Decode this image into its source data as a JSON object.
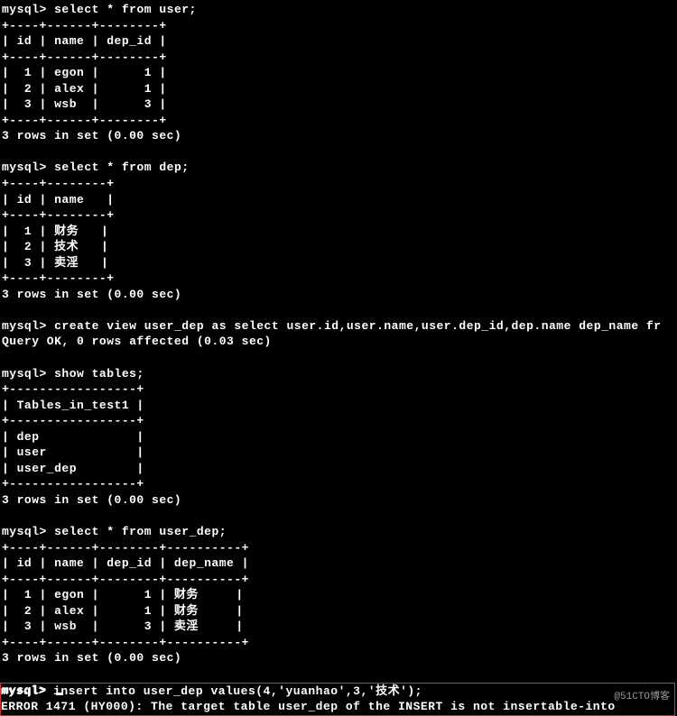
{
  "prompt_text": "mysql>",
  "queries": {
    "select_user": "select * from user;",
    "select_dep": "select * from dep;",
    "create_view": "create view user_dep as select user.id,user.name,user.dep_id,dep.name dep_name fr",
    "show_tables": "show tables;",
    "select_user_dep": "select * from user_dep;",
    "insert_user_dep": "insert into user_dep values(4,'yuanhao',3,'技术');"
  },
  "results": {
    "query_ok": "Query OK, 0 rows affected (0.03 sec)",
    "rows_in_set": "3 rows in set (0.00 sec)",
    "error_msg": "ERROR 1471 (HY000): The target table user_dep of the INSERT is not insertable-into"
  },
  "user_table": {
    "border": "+----+------+--------+",
    "header": "| id | name | dep_id |",
    "rows": [
      "|  1 | egon |      1 |",
      "|  2 | alex |      1 |",
      "|  3 | wsb  |      3 |"
    ]
  },
  "dep_table": {
    "border": "+----+--------+",
    "header": "| id | name   |",
    "rows": [
      "|  1 | 财务   |",
      "|  2 | 技术   |",
      "|  3 | 卖淫   |"
    ]
  },
  "tables_list": {
    "border": "+-----------------+",
    "header": "| Tables_in_test1 |",
    "rows": [
      "| dep             |",
      "| user            |",
      "| user_dep        |"
    ]
  },
  "user_dep_table": {
    "border": "+----+------+--------+----------+",
    "header": "| id | name | dep_id | dep_name |",
    "rows": [
      "|  1 | egon |      1 | 财务     |",
      "|  2 | alex |      1 | 财务     |",
      "|  3 | wsb  |      3 | 卖淫     |"
    ]
  },
  "watermark": "@51CTO博客"
}
